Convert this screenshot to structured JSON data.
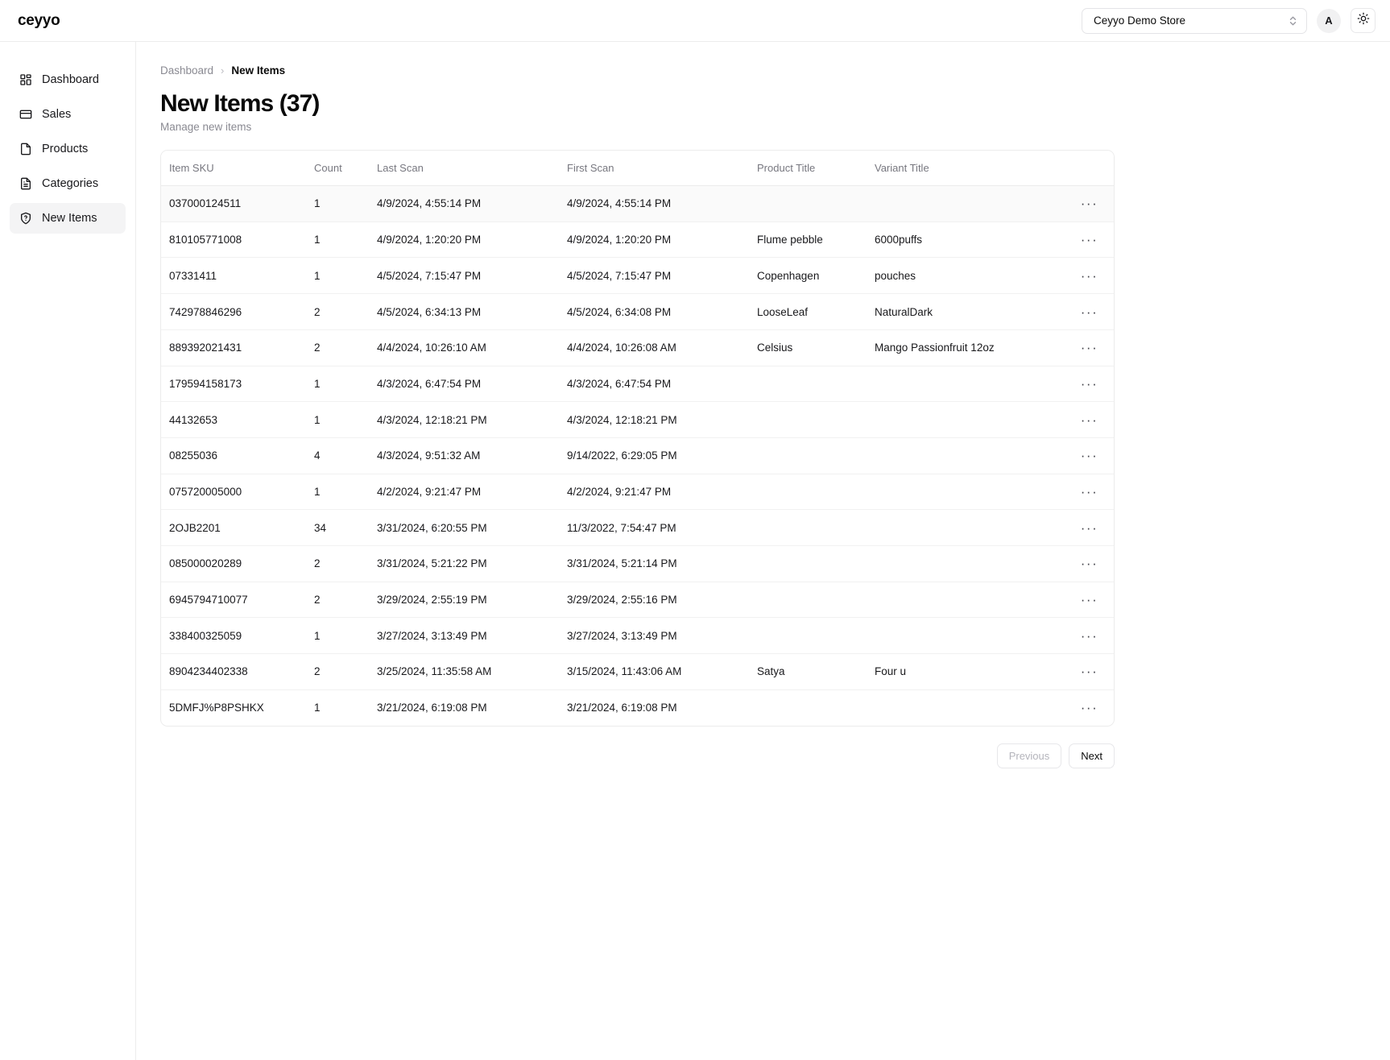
{
  "topbar": {
    "brand": "ceyyo",
    "store_select": {
      "value": "Ceyyo Demo Store",
      "icon": "chevron-updown-icon"
    },
    "avatar_initial": "A",
    "theme_toggle_icon": "sun-icon"
  },
  "sidebar": {
    "items": [
      {
        "label": "Dashboard",
        "icon": "layout-grid-icon",
        "active": false
      },
      {
        "label": "Sales",
        "icon": "credit-card-icon",
        "active": false
      },
      {
        "label": "Products",
        "icon": "file-icon",
        "active": false
      },
      {
        "label": "Categories",
        "icon": "file-text-icon",
        "active": false
      },
      {
        "label": "New Items",
        "icon": "shield-question-icon",
        "active": true
      }
    ]
  },
  "breadcrumb": {
    "parent": "Dashboard",
    "separator": "›",
    "current": "New Items"
  },
  "header": {
    "title": "New Items (37)",
    "subtitle": "Manage new items",
    "count": 37
  },
  "table": {
    "columns": [
      "Item SKU",
      "Count",
      "Last Scan",
      "First Scan",
      "Product Title",
      "Variant Title"
    ],
    "row_action_icon": "ellipsis-icon",
    "row_action_label": "···",
    "rows": [
      {
        "sku": "037000124511",
        "count": "1",
        "last_scan": "4/9/2024, 4:55:14 PM",
        "first_scan": "4/9/2024, 4:55:14 PM",
        "product": "",
        "variant": ""
      },
      {
        "sku": "810105771008",
        "count": "1",
        "last_scan": "4/9/2024, 1:20:20 PM",
        "first_scan": "4/9/2024, 1:20:20 PM",
        "product": "Flume pebble",
        "variant": "6000puffs"
      },
      {
        "sku": "07331411",
        "count": "1",
        "last_scan": "4/5/2024, 7:15:47 PM",
        "first_scan": "4/5/2024, 7:15:47 PM",
        "product": "Copenhagen",
        "variant": "pouches"
      },
      {
        "sku": "742978846296",
        "count": "2",
        "last_scan": "4/5/2024, 6:34:13 PM",
        "first_scan": "4/5/2024, 6:34:08 PM",
        "product": "LooseLeaf",
        "variant": "NaturalDark"
      },
      {
        "sku": "889392021431",
        "count": "2",
        "last_scan": "4/4/2024, 10:26:10 AM",
        "first_scan": "4/4/2024, 10:26:08 AM",
        "product": "Celsius",
        "variant": "Mango Passionfruit 12oz"
      },
      {
        "sku": "179594158173",
        "count": "1",
        "last_scan": "4/3/2024, 6:47:54 PM",
        "first_scan": "4/3/2024, 6:47:54 PM",
        "product": "",
        "variant": ""
      },
      {
        "sku": "44132653",
        "count": "1",
        "last_scan": "4/3/2024, 12:18:21 PM",
        "first_scan": "4/3/2024, 12:18:21 PM",
        "product": "",
        "variant": ""
      },
      {
        "sku": "08255036",
        "count": "4",
        "last_scan": "4/3/2024, 9:51:32 AM",
        "first_scan": "9/14/2022, 6:29:05 PM",
        "product": "",
        "variant": ""
      },
      {
        "sku": "075720005000",
        "count": "1",
        "last_scan": "4/2/2024, 9:21:47 PM",
        "first_scan": "4/2/2024, 9:21:47 PM",
        "product": "",
        "variant": ""
      },
      {
        "sku": "2OJB2201",
        "count": "34",
        "last_scan": "3/31/2024, 6:20:55 PM",
        "first_scan": "11/3/2022, 7:54:47 PM",
        "product": "",
        "variant": ""
      },
      {
        "sku": "085000020289",
        "count": "2",
        "last_scan": "3/31/2024, 5:21:22 PM",
        "first_scan": "3/31/2024, 5:21:14 PM",
        "product": "",
        "variant": ""
      },
      {
        "sku": "6945794710077",
        "count": "2",
        "last_scan": "3/29/2024, 2:55:19 PM",
        "first_scan": "3/29/2024, 2:55:16 PM",
        "product": "",
        "variant": ""
      },
      {
        "sku": "338400325059",
        "count": "1",
        "last_scan": "3/27/2024, 3:13:49 PM",
        "first_scan": "3/27/2024, 3:13:49 PM",
        "product": "",
        "variant": ""
      },
      {
        "sku": "8904234402338",
        "count": "2",
        "last_scan": "3/25/2024, 11:35:58 AM",
        "first_scan": "3/15/2024, 11:43:06 AM",
        "product": "Satya",
        "variant": "Four u"
      },
      {
        "sku": "5DMFJ%P8PSHKX",
        "count": "1",
        "last_scan": "3/21/2024, 6:19:08 PM",
        "first_scan": "3/21/2024, 6:19:08 PM",
        "product": "",
        "variant": ""
      }
    ]
  },
  "pagination": {
    "previous": "Previous",
    "next": "Next",
    "previous_disabled": true
  }
}
